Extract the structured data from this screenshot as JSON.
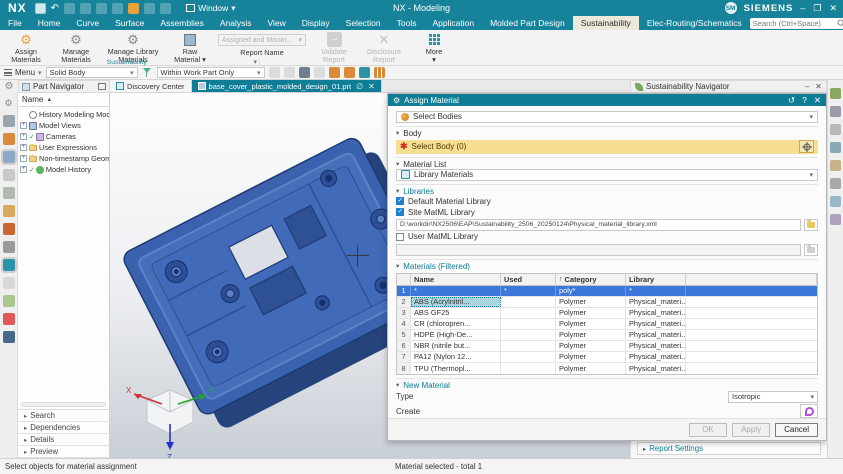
{
  "titlebar": {
    "logo": "NX",
    "title": "NX - Modeling",
    "window_menu": "Window",
    "window_caret": "▾",
    "avatar": "SM",
    "brand": "SIEMENS",
    "controls": {
      "minimize": "–",
      "restore": "❐",
      "close": "✕"
    },
    "undo_glyph": "↶"
  },
  "tabs_row": {
    "tabs": [
      "File",
      "Home",
      "Curve",
      "Surface",
      "Assemblies",
      "Analysis",
      "View",
      "Display",
      "Selection",
      "Tools",
      "Application",
      "Molded Part Design",
      "Sustainability",
      "Elec-Routing/Schematics"
    ],
    "active_tab": "Sustainability",
    "search_placeholder": "Search (Ctrl+Space)",
    "right_icons": {
      "expand": "⛶",
      "minimize_ribbon": "^",
      "help": "◷",
      "pin": "|"
    }
  },
  "ribbon": {
    "group_label": "Sustainability",
    "launcher_caret": "▾",
    "buttons": [
      {
        "label1": "Assign",
        "label2": "Materials"
      },
      {
        "label1": "Manage",
        "label2": "Materials"
      },
      {
        "label1": "Manage Library",
        "label2": "Materials"
      },
      {
        "label1": "Raw",
        "label2": "Material ▾"
      }
    ],
    "report_name_value": "Assigned and Missin...",
    "report_caret": "▾",
    "report_name_label": "Report Name",
    "validate_label1": "Validate",
    "validate_label2": "Report",
    "disclosure_label1": "Disclosure",
    "disclosure_label2": "Report",
    "more_label": "More",
    "more_caret": "▾",
    "arrow_glyph": "→",
    "x_glyph": "✕",
    "gear_glyph": "⚙"
  },
  "toolbar": {
    "menu_label": "Menu",
    "menu_caret": "▾",
    "selection_type": "Solid Body",
    "selection_scope": "Within Work Part Only",
    "combo_caret": "▾",
    "icons": [
      {
        "name": "snap-point-icon",
        "style": "dis"
      },
      {
        "name": "selection-prediction-icon",
        "style": "dis"
      },
      {
        "name": "cursor-icon",
        "style": "dark"
      },
      {
        "name": "general-selection-icon",
        "style": "dis"
      },
      {
        "name": "solid-face-icon",
        "style": "orange"
      },
      {
        "name": "body-select-icon",
        "style": "orange"
      },
      {
        "name": "globe-icon",
        "style": "teal"
      },
      {
        "name": "touch-grid-icon",
        "style": "grid"
      }
    ]
  },
  "left_rail": {
    "icons": [
      {
        "name": "resource-options-gear-icon",
        "glyph": "⚙",
        "color": "#8a8a8a",
        "selected": false
      },
      {
        "name": "roles-icon",
        "glyph": "",
        "color": "#9aa5ad",
        "selected": false
      },
      {
        "name": "assembly-navigator-icon",
        "glyph": "",
        "color": "#D98B3A",
        "selected": false
      },
      {
        "name": "part-navigator-icon",
        "glyph": "",
        "color": "#8FA8C8",
        "selected": true
      },
      {
        "name": "notification-bell-icon",
        "glyph": "",
        "color": "#c8c8c8",
        "selected": false
      },
      {
        "name": "recycle-bin-icon",
        "glyph": "",
        "color": "#b0b8b0",
        "selected": false
      },
      {
        "name": "reuse-library-icon",
        "glyph": "",
        "color": "#D9A85A",
        "selected": false
      },
      {
        "name": "product-template-icon",
        "glyph": "",
        "color": "#C86830",
        "selected": false
      },
      {
        "name": "material-sphere-icon",
        "glyph": "",
        "color": "#9a9a9a",
        "selected": false
      },
      {
        "name": "web-browser-icon",
        "glyph": "",
        "color": "#2A93A8",
        "selected": true
      },
      {
        "name": "history-clock-icon",
        "glyph": "",
        "color": "#d8d8d8",
        "selected": false
      },
      {
        "name": "image-gallery-icon",
        "glyph": "",
        "color": "#A8C890",
        "selected": false
      },
      {
        "name": "color-ramp-icon",
        "glyph": "",
        "color": "#E05858",
        "selected": false
      },
      {
        "name": "knowledge-fusion-icon",
        "glyph": "",
        "color": "#486888",
        "selected": false
      }
    ]
  },
  "part_navigator": {
    "title": "Part Navigator",
    "name_column": "Name",
    "sort_glyph": "▲",
    "tree": [
      {
        "label": "History Modeling Mode",
        "expander": false,
        "icon": "clock",
        "check": false
      },
      {
        "label": "Model Views",
        "expander": true,
        "icon": "views",
        "check": false
      },
      {
        "label": "Cameras",
        "expander": true,
        "icon": "camera",
        "check": true
      },
      {
        "label": "User Expressions",
        "expander": true,
        "icon": "folder",
        "check": false
      },
      {
        "label": "Non-timestamp Geometry",
        "expander": true,
        "icon": "folder",
        "check": false
      },
      {
        "label": "Model History",
        "expander": true,
        "icon": "hist",
        "check": true
      }
    ],
    "sections": [
      "Search",
      "Dependencies",
      "Details",
      "Preview"
    ],
    "section_caret": "▸",
    "expander_glyph": "+"
  },
  "document_tabs": {
    "discovery": "Discovery Center",
    "part_file": "base_cover_plastic_molded_design_01.prt",
    "block_glyph": "∅",
    "close_glyph": "✕"
  },
  "dialog": {
    "title": "Assign Material",
    "gear_glyph": "⚙",
    "reset_glyph": "↺",
    "help_glyph": "?",
    "close_glyph": "✕",
    "select_bodies": "Select Bodies",
    "combo_caret": "▾",
    "section_caret_open": "▾",
    "sections": {
      "body": "Body",
      "material_list": "Material List",
      "libraries": "Libraries",
      "materials": "Materials (Filtered)",
      "new_material": "New Material"
    },
    "select_body": "Select Body (0)",
    "library_materials": "Library Materials",
    "default_lib": "Default Material Library",
    "site_lib": "Site MatML Library",
    "site_lib_path": "D:\\workdir\\NX2506\\EAP\\Sustainability_2506_20250124\\Physical_material_library.xml",
    "user_lib": "User MatML Library",
    "table": {
      "headers": [
        "Name",
        "Used",
        "Category",
        "Library"
      ],
      "category_sort_glyph": "↑",
      "filter_row": {
        "num": "1",
        "name": "*",
        "used": "*",
        "category": "poly*",
        "library": "*"
      },
      "rows": [
        {
          "num": "2",
          "name": "ABS (Acrylnitril...",
          "used": "",
          "category": "Polymer",
          "library": "Physical_materi..."
        },
        {
          "num": "3",
          "name": "ABS GF25",
          "used": "",
          "category": "Polymer",
          "library": "Physical_materi..."
        },
        {
          "num": "4",
          "name": "CR (chloropren...",
          "used": "",
          "category": "Polymer",
          "library": "Physical_materi..."
        },
        {
          "num": "5",
          "name": "HDPE (High-De...",
          "used": "",
          "category": "Polymer",
          "library": "Physical_materi..."
        },
        {
          "num": "6",
          "name": "NBR (nitrile but...",
          "used": "",
          "category": "Polymer",
          "library": "Physical_materi..."
        },
        {
          "num": "7",
          "name": "PA12 (Nylon 12...",
          "used": "",
          "category": "Polymer",
          "library": "Physical_materi..."
        },
        {
          "num": "8",
          "name": "TPU (Thermopl...",
          "used": "",
          "category": "Polymer",
          "library": "Physical_materi..."
        }
      ]
    },
    "type_label": "Type",
    "type_value": "Isotropic",
    "create_label": "Create",
    "ok": "OK",
    "apply": "Apply",
    "cancel": "Cancel"
  },
  "sustainability_navigator": {
    "title": "Sustainability Navigator",
    "minimize_glyph": "–",
    "close_glyph": "✕",
    "report_settings": "Report Settings",
    "caret": "▸"
  },
  "right_rail": {
    "icons": [
      {
        "name": "checkmate-icon",
        "color": "#8aa860"
      },
      {
        "name": "dimension-icon",
        "color": "#9a9aa8"
      },
      {
        "name": "annotation-icon",
        "color": "#b8b8b8"
      },
      {
        "name": "measure-icon",
        "color": "#88a8b8"
      },
      {
        "name": "pmi-icon",
        "color": "#c8b088"
      },
      {
        "name": "view-section-icon",
        "color": "#a8a8a8"
      },
      {
        "name": "layer-icon",
        "color": "#98b8c8"
      },
      {
        "name": "display-mode-icon",
        "color": "#b0a0c0"
      }
    ]
  },
  "status_bar": {
    "left": "Select objects for material assignment",
    "center": "Material selected - total 1"
  },
  "viewport": {
    "axis_x": "X",
    "axis_y": "Y",
    "axis_z": "Z"
  }
}
